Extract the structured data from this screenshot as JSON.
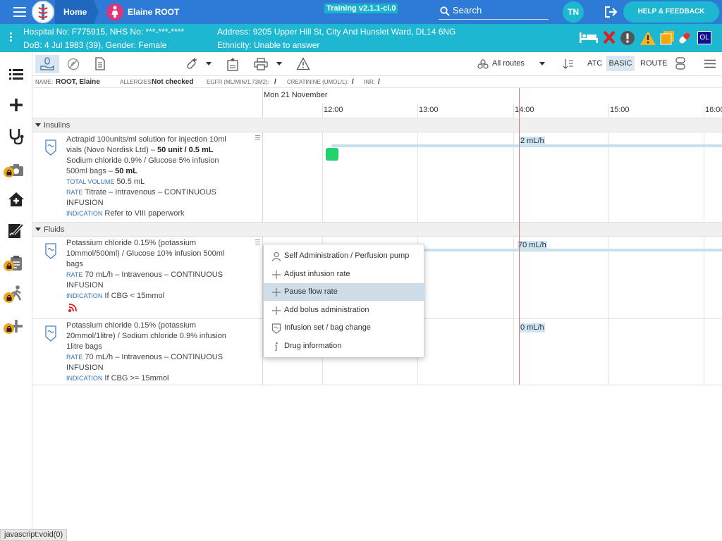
{
  "topbar": {
    "home_label": "Home",
    "patient_name": "Elaine ROOT",
    "training_label": "Training v2.1.1-ci.0",
    "search_label": "Search",
    "user_initials": "TN",
    "help_label": "HELP & FEEDBACK"
  },
  "patient_bar": {
    "hospital_line": "Hospital No: F775915, NHS No: ***-***-****",
    "dob_line": "DoB: 4 Jul 1983 (39), Gender: Female",
    "address_line": "Address: 9205 Upper Hill St, City And Hunslet Ward, DL14 6NG",
    "ethnicity_line": "Ethnicity: Unable to answer",
    "ol_badge": "OL"
  },
  "toolbar": {
    "routes_label": "All routes",
    "atc_label": "ATC",
    "basic_label": "BASIC",
    "route_label": "ROUTE"
  },
  "info_bar": {
    "name_label": "NAME:",
    "name_value": "ROOT, Elaine",
    "allergies_label": "ALLERGIES:",
    "allergies_value": "Not checked",
    "egfr_label": "EGFR (ML/MIN/1.73M2):",
    "egfr_value": "/",
    "creatinine_label": "CREATININE (UMOL/L):",
    "creatinine_value": "/",
    "inr_label": "INR:",
    "inr_value": "/"
  },
  "timeline": {
    "date_label": "Mon 21 November",
    "ticks": [
      "12:00",
      "13:00",
      "14:00",
      "15:00",
      "16:00"
    ]
  },
  "groups": {
    "insulins": "Insulins",
    "fluids": "Fluids"
  },
  "drug1": {
    "line1": "Actrapid 100units/ml solution for injection 10ml",
    "line2a": "vials (Novo Nordisk Ltd) – ",
    "line2b": "50 unit / 0.5 mL",
    "line3": "Sodium chloride 0.9% / Glucose 5% infusion",
    "line4a": "500ml bags – ",
    "line4b": "50 mL",
    "tv_label": "TOTAL VOLUME",
    "tv_value": "50.5 mL",
    "rate_label": "RATE",
    "rate_value": "Titrate – Intravenous – CONTINUOUS",
    "rate_value2": "INFUSION",
    "ind_label": "INDICATION",
    "ind_value": "Refer to VIII paperwork",
    "rate_chip": "2 mL/h"
  },
  "drug2": {
    "line1": "Potassium chloride 0.15% (potassium",
    "line2": "10mmol/500ml) / Glucose 10% infusion 500ml",
    "line3": "bags",
    "rate_label": "RATE",
    "rate_value": "70 mL/h – Intravenous – CONTINUOUS",
    "rate_value2": "INFUSION",
    "ind_label": "INDICATION",
    "ind_value": "If CBG < 15mmol",
    "rate_chip": "70 mL/h"
  },
  "drug3": {
    "line1": "Potassium chloride 0.15% (potassium",
    "line2": "20mmol/1litre) / Sodium chloride 0.9% infusion",
    "line3": "1litre bags",
    "rate_label": "RATE",
    "rate_value": "70 mL/h – Intravenous – CONTINUOUS",
    "rate_value2": "INFUSION",
    "ind_label": "INDICATION",
    "ind_value": "If CBG >= 15mmol",
    "rate_chip": "0 mL/h"
  },
  "context_menu": {
    "self_admin": "Self Administration / Perfusion pump",
    "adjust": "Adjust infusion rate",
    "pause": "Pause flow rate",
    "bolus": "Add bolus administration",
    "bag_change": "Infusion set / bag change",
    "drug_info": "Drug information"
  },
  "status_bar": "javascript:void(0)",
  "colors": {
    "topbar": "#2d7bd4",
    "patient_bar": "#1eb7d1",
    "now_line": "#e4736a",
    "admin_marker": "#22d36b"
  }
}
